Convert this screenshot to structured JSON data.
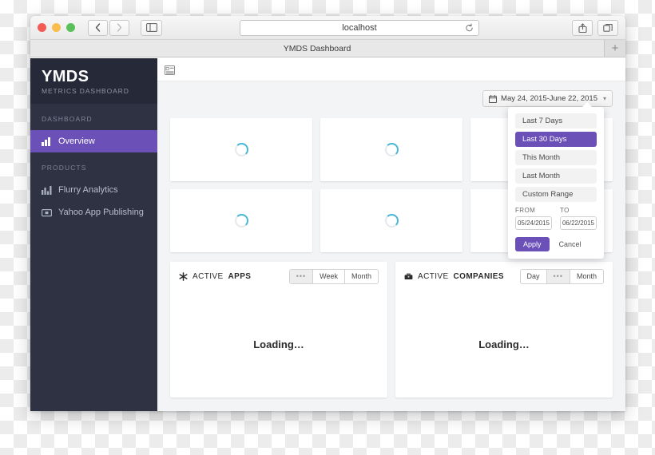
{
  "browser": {
    "url": "localhost",
    "tab_title": "YMDS Dashboard",
    "new_tab_label": "+",
    "back_icon": "chevron-left-icon",
    "forward_icon": "chevron-right-icon",
    "sidebar_icon": "sidebar-panel-icon",
    "reload_icon": "reload-icon",
    "share_icon": "share-icon",
    "tabs_icon": "show-tabs-icon"
  },
  "sidebar": {
    "brand": {
      "title": "YMDS",
      "subtitle": "METRICS DASHBOARD"
    },
    "sections": [
      {
        "label": "DASHBOARD",
        "items": [
          {
            "label": "Overview",
            "icon": "chart-bars-icon",
            "active": true
          }
        ]
      },
      {
        "label": "PRODUCTS",
        "items": [
          {
            "label": "Flurry Analytics",
            "icon": "bar-chart-icon",
            "active": false
          },
          {
            "label": "Yahoo App Publishing",
            "icon": "money-card-icon",
            "active": false
          }
        ]
      }
    ]
  },
  "main": {
    "menu_toggle_icon": "list-menu-icon",
    "daterange": {
      "calendar_icon": "calendar-icon",
      "label": "May 24, 2015-June 22, 2015",
      "chevron_icon": "chevron-down-icon"
    },
    "dropdown": {
      "options": [
        {
          "label": "Last 7 Days",
          "selected": false
        },
        {
          "label": "Last 30 Days",
          "selected": true
        },
        {
          "label": "This Month",
          "selected": false
        },
        {
          "label": "Last Month",
          "selected": false
        },
        {
          "label": "Custom Range",
          "selected": false
        }
      ],
      "from_label": "FROM",
      "to_label": "TO",
      "from_value": "05/24/2015",
      "to_value": "06/22/2015",
      "apply_label": "Apply",
      "cancel_label": "Cancel"
    },
    "stat_cards": [
      {
        "state": "loading"
      },
      {
        "state": "loading"
      },
      {
        "state": "loading"
      },
      {
        "state": "loading"
      },
      {
        "state": "loading"
      },
      {
        "state": "loading"
      }
    ],
    "panels": [
      {
        "icon": "gear-asterisk-icon",
        "title_light": "ACTIVE ",
        "title_strong": "APPS",
        "segments": [
          {
            "label": "•••",
            "active": true
          },
          {
            "label": "Week",
            "active": false
          },
          {
            "label": "Month",
            "active": false
          }
        ],
        "body_text": "Loading…"
      },
      {
        "icon": "briefcase-icon",
        "title_light": "ACTIVE ",
        "title_strong": "COMPANIES",
        "segments": [
          {
            "label": "Day",
            "active": false
          },
          {
            "label": "•••",
            "active": true
          },
          {
            "label": "Month",
            "active": false
          }
        ],
        "body_text": "Loading…"
      }
    ]
  },
  "colors": {
    "accent_purple": "#6b50b8",
    "sidebar_bg": "#2e3243",
    "sidebar_header_bg": "#262a38",
    "spinner_accent": "#46b7d6",
    "page_bg": "#f3f4f6"
  }
}
